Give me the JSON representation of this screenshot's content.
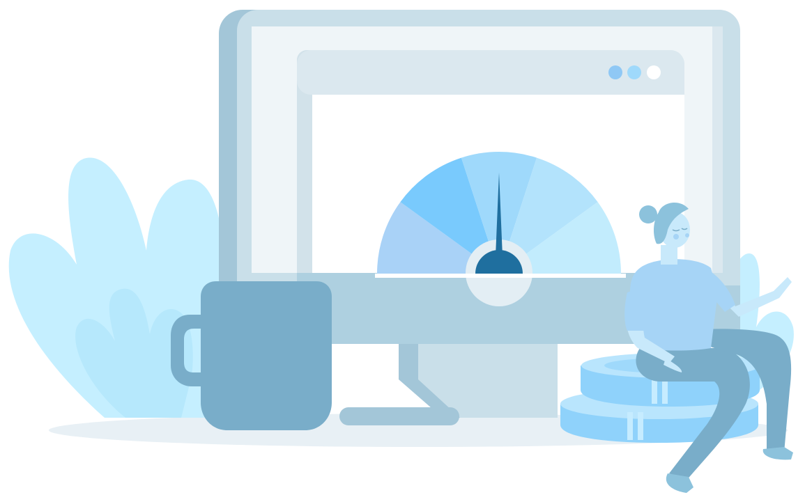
{
  "illustration": {
    "gauge": {
      "level": 0.5
    },
    "window_controls": [
      {
        "name": "window-dot-1",
        "color": "#8fc8f5"
      },
      {
        "name": "window-dot-2",
        "color": "#9fd9fb"
      },
      {
        "name": "window-dot-3",
        "color": "#ffffff"
      }
    ],
    "palette": {
      "monitor_frame": "#a3c6d8",
      "monitor_screen": "#eff5f8",
      "browser_bar": "#dbe8ef",
      "mug": "#79adc9",
      "foliage": "#c5efff",
      "gauge_needle": "#1f6f9f",
      "coins": "#8fd2fb",
      "figure_jeans": "#79adc9",
      "figure_top": "#a6d4f6"
    }
  }
}
